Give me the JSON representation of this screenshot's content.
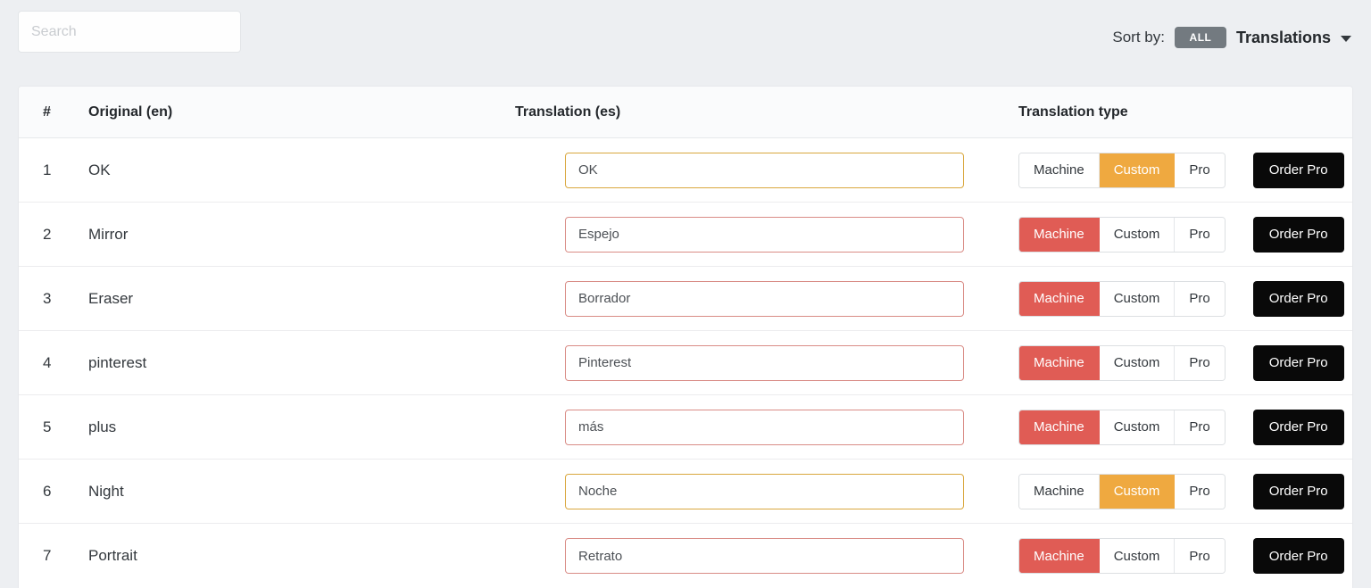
{
  "search": {
    "placeholder": "Search",
    "value": ""
  },
  "sort": {
    "label": "Sort by:",
    "badge": "ALL",
    "selected": "Translations",
    "caret_icon": "chevron-down-icon"
  },
  "table": {
    "headers": {
      "number": "#",
      "original": "Original (en)",
      "translation": "Translation (es)",
      "type": "Translation type"
    },
    "segment_labels": {
      "machine": "Machine",
      "custom": "Custom",
      "pro": "Pro"
    },
    "order_pro_label": "Order Pro",
    "rows": [
      {
        "num": "1",
        "original": "OK",
        "translation": "OK",
        "state": "custom"
      },
      {
        "num": "2",
        "original": "Mirror",
        "translation": "Espejo",
        "state": "machine"
      },
      {
        "num": "3",
        "original": "Eraser",
        "translation": "Borrador",
        "state": "machine"
      },
      {
        "num": "4",
        "original": "pinterest",
        "translation": "Pinterest",
        "state": "machine"
      },
      {
        "num": "5",
        "original": "plus",
        "translation": "más",
        "state": "machine"
      },
      {
        "num": "6",
        "original": "Night",
        "translation": "Noche",
        "state": "custom"
      },
      {
        "num": "7",
        "original": "Portrait",
        "translation": "Retrato",
        "state": "machine"
      }
    ]
  },
  "colors": {
    "page_background": "#edeff2",
    "machine_active": "#e05c55",
    "custom_active": "#efa940",
    "order_pro_background": "#090909",
    "badge_background": "#737a80"
  }
}
